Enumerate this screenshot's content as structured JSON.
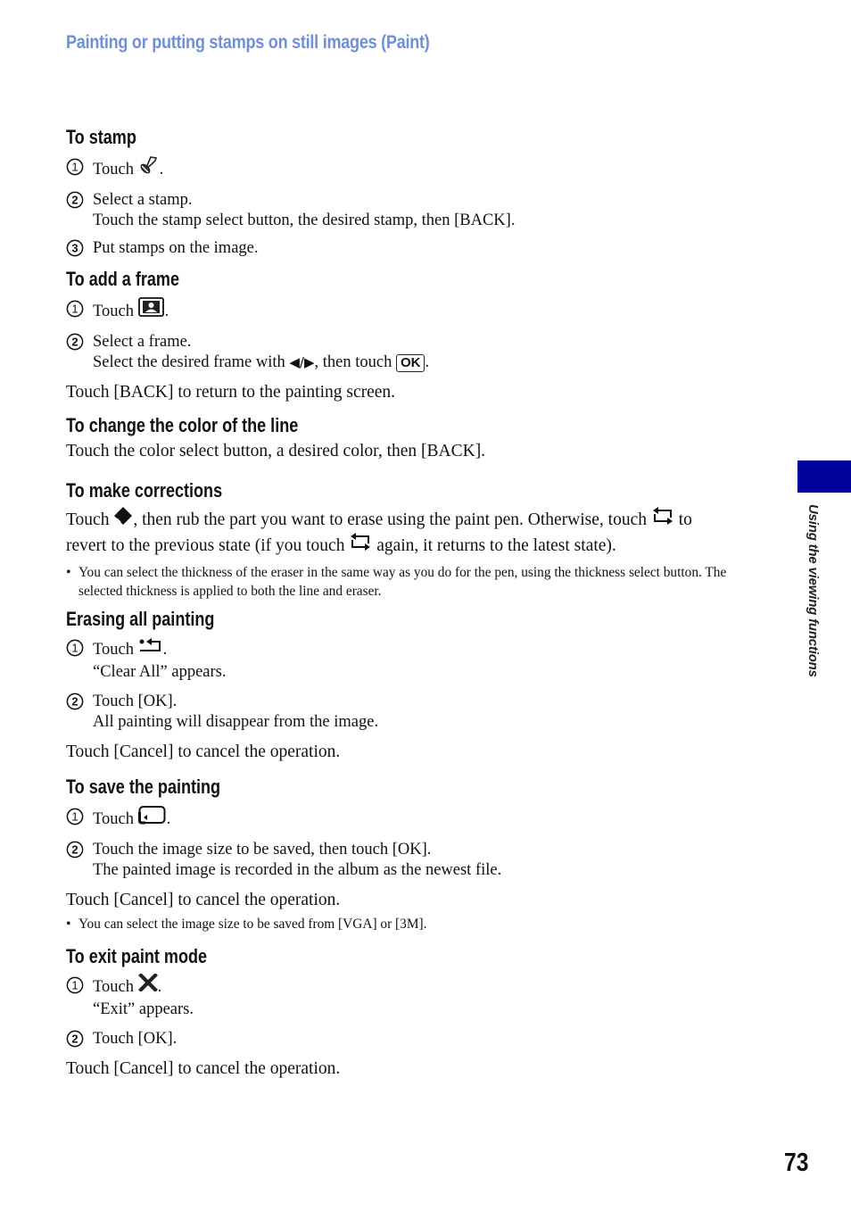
{
  "header": {
    "title": "Painting or putting stamps on still images (Paint)"
  },
  "side_tab": {
    "label": "Using the viewing functions",
    "color": "#00009a"
  },
  "page_number": "73",
  "sections": {
    "stamp": {
      "heading": "To stamp",
      "steps": [
        {
          "num": "1",
          "text_before": "Touch",
          "icon": "stamp-icon",
          "text_after": "."
        },
        {
          "num": "2",
          "line1": "Select a stamp.",
          "line2": "Touch the stamp select button, the desired stamp, then [BACK]."
        },
        {
          "num": "3",
          "line1": "Put stamps on the image."
        }
      ]
    },
    "frame": {
      "heading": "To add a frame",
      "steps": [
        {
          "num": "1",
          "text_before": "Touch",
          "icon": "frame-icon",
          "text_after": "."
        },
        {
          "num": "2",
          "line1": "Select a frame.",
          "line2_before": "Select the desired frame with",
          "line2_arrows": "◀/▶",
          "line2_mid": ", then touch",
          "line2_button": "OK",
          "line2_after": "."
        }
      ],
      "after": "Touch [BACK] to return to the painting screen."
    },
    "color": {
      "heading": "To change the color of the line",
      "text": "Touch the color select button, a desired color, then [BACK]."
    },
    "corrections": {
      "heading": "To make corrections",
      "p1_a": "Touch",
      "p1_b": ", then rub the part you want to erase using the paint pen. Otherwise, touch",
      "p1_c": "to",
      "p2_a": "revert to the previous state (if you touch",
      "p2_b": "again, it returns to the latest state).",
      "note": "You can select the thickness of the eraser in the same way as you do for the pen, using the thickness select button. The selected thickness is applied to both the line and eraser."
    },
    "erase_all": {
      "heading": "Erasing all painting",
      "steps": [
        {
          "num": "1",
          "text_before": "Touch",
          "icon": "clear-all-icon",
          "text_after": ".",
          "line2": "“Clear All” appears."
        },
        {
          "num": "2",
          "line1": "Touch [OK].",
          "line2": "All painting will disappear from the image."
        }
      ],
      "after": "Touch [Cancel] to cancel the operation."
    },
    "save": {
      "heading": "To save the painting",
      "steps": [
        {
          "num": "1",
          "text_before": "Touch",
          "icon": "save-icon",
          "text_after": "."
        },
        {
          "num": "2",
          "line1": "Touch the image size to be saved, then touch [OK].",
          "line2": "The painted image is recorded in the album as the newest file."
        }
      ],
      "after": "Touch [Cancel] to cancel the operation.",
      "note": "You can select the image size to be saved from [VGA] or [3M]."
    },
    "exit": {
      "heading": "To exit paint mode",
      "steps": [
        {
          "num": "1",
          "text_before": "Touch",
          "icon": "exit-icon",
          "text_after": ".",
          "line2": "“Exit” appears."
        },
        {
          "num": "2",
          "line1": "Touch [OK]."
        }
      ],
      "after": "Touch [Cancel] to cancel the operation."
    }
  },
  "bullet": "•"
}
